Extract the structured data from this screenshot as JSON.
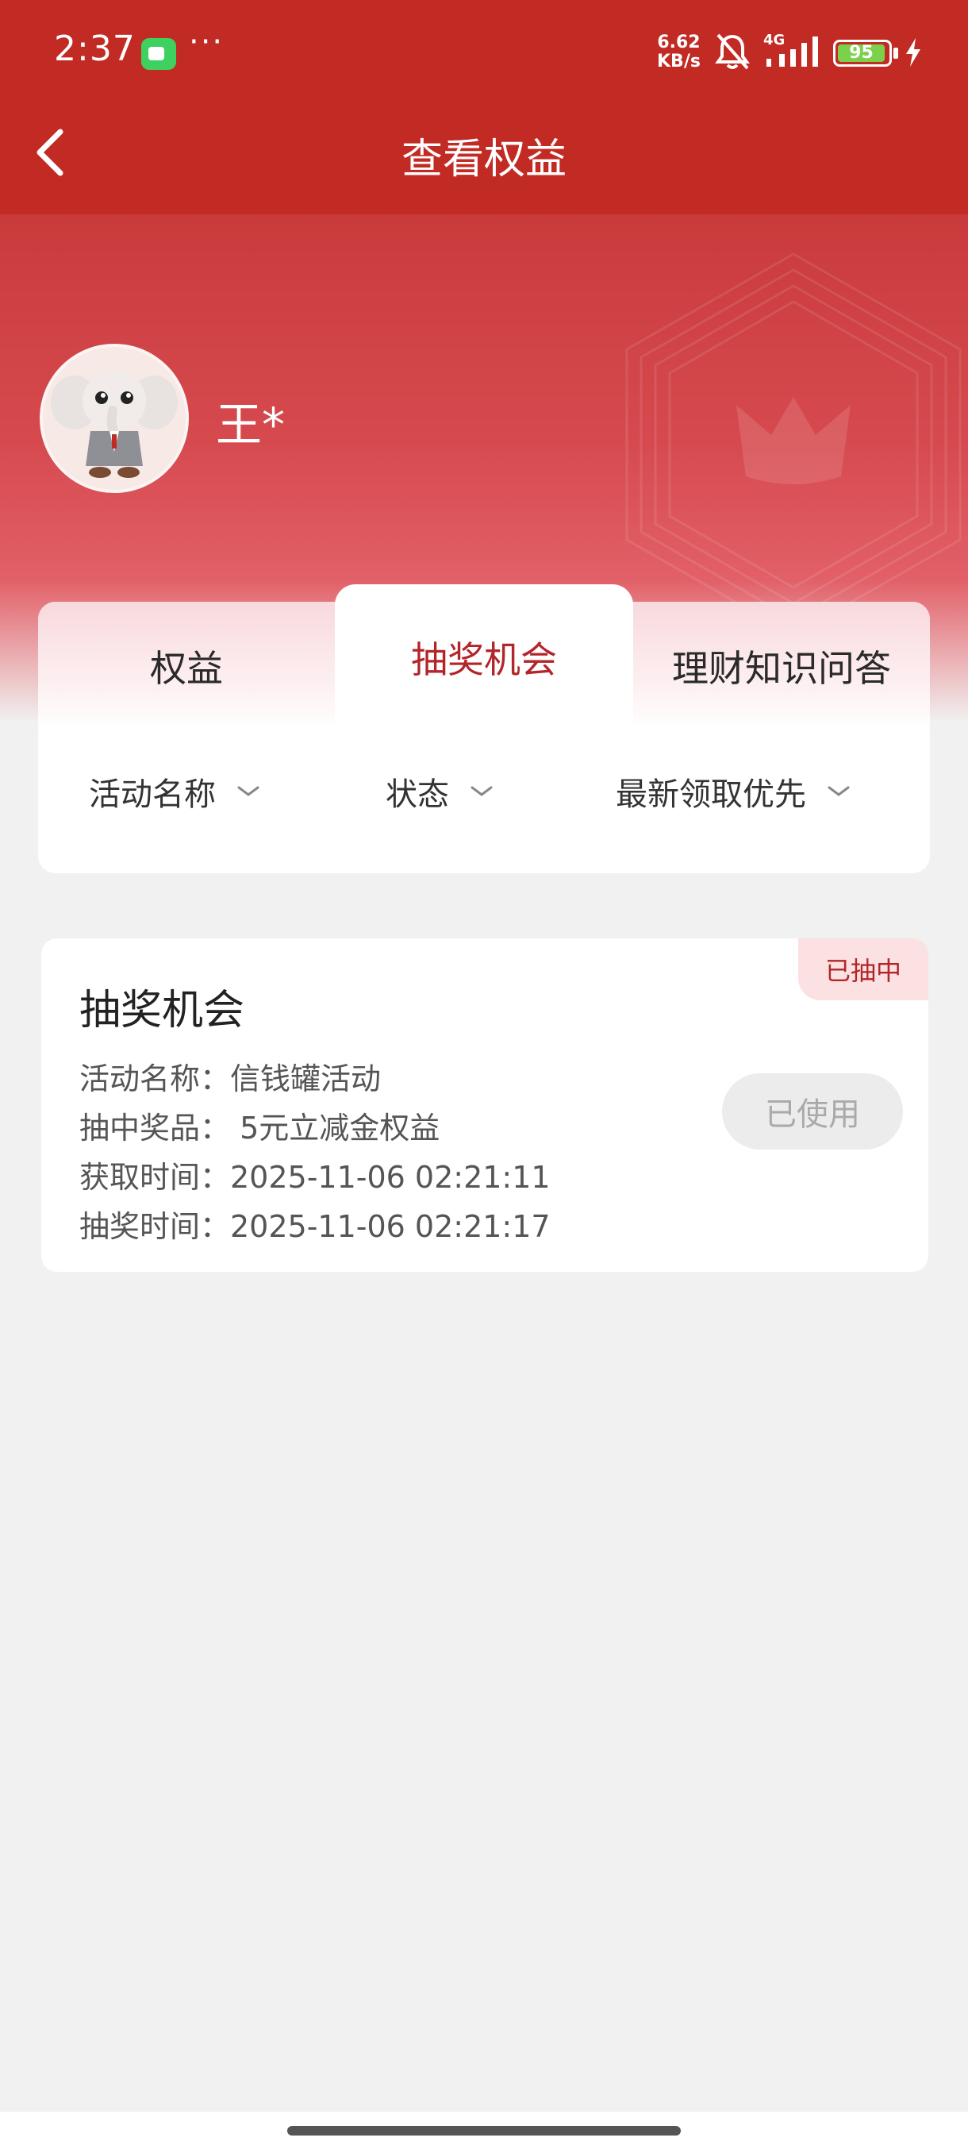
{
  "status_bar": {
    "time": "2:37",
    "more": "···",
    "net_speed_value": "6.62",
    "net_speed_unit": "KB/s",
    "signal_label": "4G",
    "battery_level": 95,
    "battery_text": "95"
  },
  "nav": {
    "title": "查看权益"
  },
  "user": {
    "name": "王*"
  },
  "tabs": [
    {
      "label": "权益",
      "active": false
    },
    {
      "label": "抽奖机会",
      "active": true
    },
    {
      "label": "理财知识问答",
      "active": false
    }
  ],
  "filters": [
    {
      "label": "活动名称"
    },
    {
      "label": "状态"
    },
    {
      "label": "最新领取优先"
    }
  ],
  "card": {
    "badge": "已抽中",
    "title": "抽奖机会",
    "rows": [
      "活动名称：信钱罐活动",
      "抽中奖品： 5元立减金权益",
      "获取时间：2025-11-06 02:21:11",
      "抽奖时间：2025-11-06 02:21:17"
    ],
    "action_label": "已使用"
  },
  "colors": {
    "brand_red": "#c22a24",
    "active_tab_text": "#b3252a",
    "badge_bg": "#fbe1e1"
  }
}
